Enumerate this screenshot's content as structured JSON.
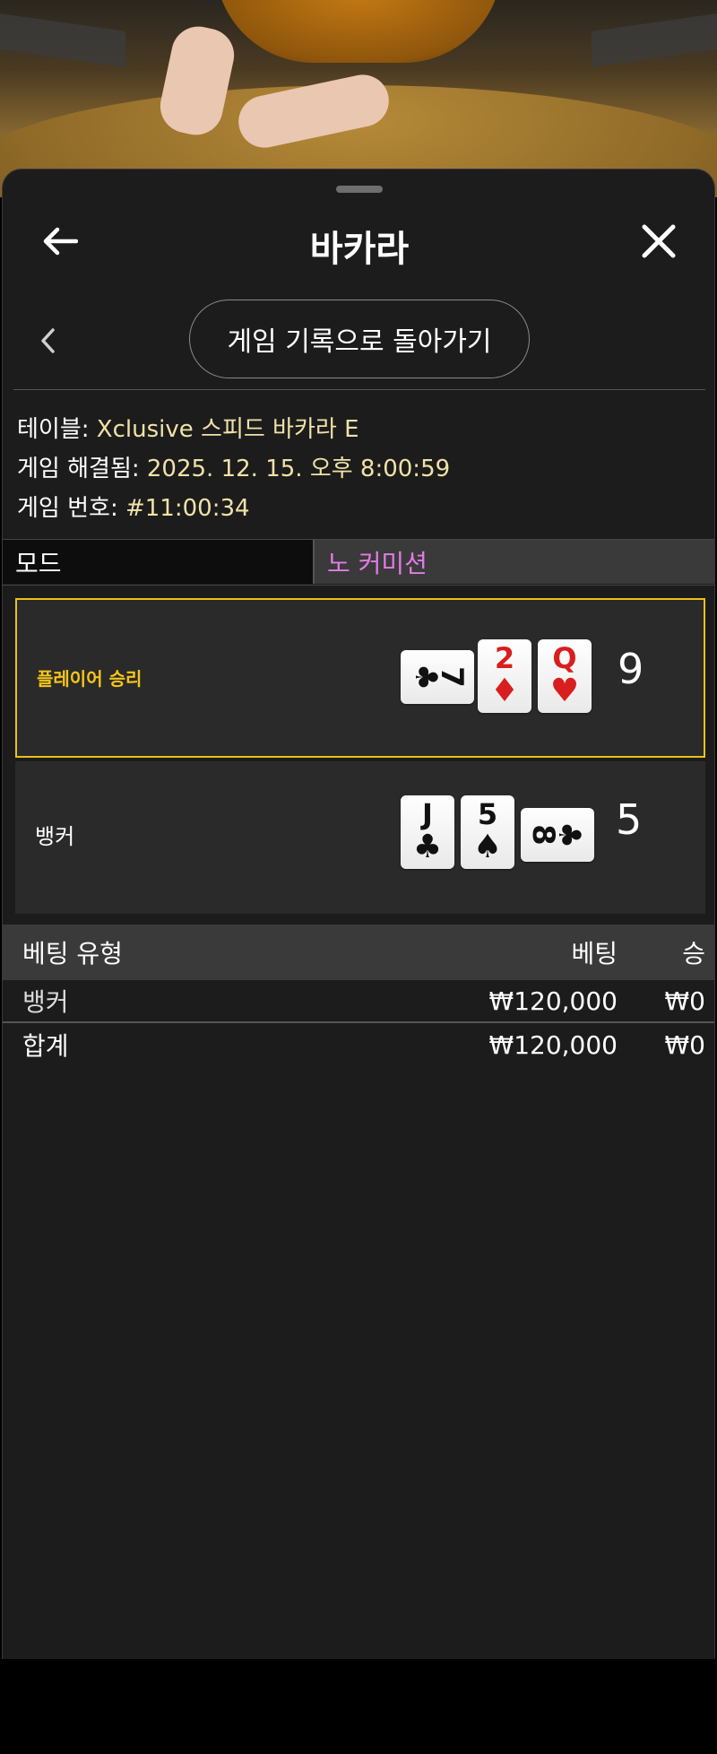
{
  "header": {
    "title": "바카라"
  },
  "nav": {
    "back_to_history_label": "게임 기록으로 돌아가기"
  },
  "info": {
    "table_label": "테이블:",
    "table_value": "Xclusive 스피드 바카라 E",
    "resolved_label": "게임 해결됨:",
    "resolved_value": "2025. 12. 15. 오후 8:00:59",
    "game_no_label": "게임 번호:",
    "game_no_value": "#11:00:34"
  },
  "mode": {
    "label": "모드",
    "value": "노 커미션"
  },
  "results": {
    "player": {
      "label": "플레이어 승리",
      "score": "9",
      "cards": [
        {
          "rank": "7",
          "suit": "♣",
          "color": "black",
          "orientation": "horizontal"
        },
        {
          "rank": "2",
          "suit": "♦",
          "color": "red",
          "orientation": "vertical"
        },
        {
          "rank": "Q",
          "suit": "♥",
          "color": "red",
          "orientation": "vertical"
        }
      ]
    },
    "banker": {
      "label": "뱅커",
      "score": "5",
      "cards": [
        {
          "rank": "J",
          "suit": "♣",
          "color": "black",
          "orientation": "vertical"
        },
        {
          "rank": "5",
          "suit": "♠",
          "color": "black",
          "orientation": "vertical"
        },
        {
          "rank": "8",
          "suit": "♣",
          "color": "black",
          "orientation": "horizontal"
        }
      ]
    }
  },
  "bets": {
    "headers": {
      "type": "베팅 유형",
      "bet": "베팅",
      "win": "승"
    },
    "rows": [
      {
        "type": "뱅커",
        "bet": "₩120,000",
        "win": "₩0"
      }
    ],
    "total": {
      "type": "합계",
      "bet": "₩120,000",
      "win": "₩0"
    }
  },
  "colors": {
    "winner_border": "#e8c21a",
    "winner_label": "#f5c518",
    "mode_value": "#e17be6",
    "info_value": "#f0e2a8"
  },
  "icons": [
    "back-arrow-icon",
    "close-icon",
    "chevron-left-icon"
  ]
}
